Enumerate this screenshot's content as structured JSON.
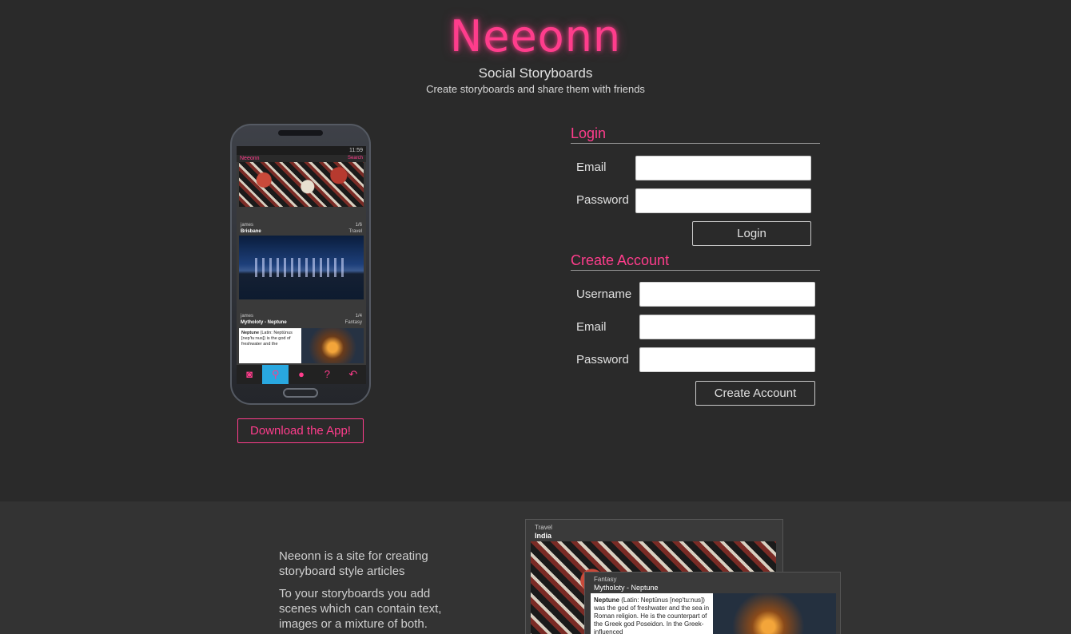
{
  "header": {
    "logo": "Neeonn",
    "tagline": "Social Storyboards",
    "subtagline": "Create storyboards and share them with friends"
  },
  "phone": {
    "status_time": "11:59",
    "app_brand": "Neeonn",
    "search_label": "Search",
    "card1": {
      "user": "james",
      "count": "1/6",
      "title": "Brisbane",
      "category": "Travel"
    },
    "card2": {
      "user": "james",
      "count": "1/4",
      "title": "Mytholoty - Neptune",
      "category": "Fantasy"
    },
    "snippet_bold": "Neptune",
    "snippet_text": "(Latin: Neptūnus [nep'tu:nus]) is the god of freshwater and the",
    "tabs": [
      {
        "icon": "camera-icon",
        "glyph": "◙"
      },
      {
        "icon": "search-icon",
        "glyph": "⚲"
      },
      {
        "icon": "user-icon",
        "glyph": "●"
      },
      {
        "icon": "help-icon",
        "glyph": "?"
      },
      {
        "icon": "back-icon",
        "glyph": "↶"
      }
    ]
  },
  "download_button": "Download the App!",
  "login": {
    "title": "Login",
    "email_label": "Email",
    "password_label": "Password",
    "button": "Login"
  },
  "create": {
    "title": "Create Account",
    "username_label": "Username",
    "email_label": "Email",
    "password_label": "Password",
    "button": "Create Account"
  },
  "about": {
    "p1": "Neeonn is a site for creating storyboard style articles",
    "p2": "To your storyboards you add scenes which can contain text, images or a mixture of both."
  },
  "preview1": {
    "category": "Travel",
    "title": "India"
  },
  "preview2": {
    "category": "Fantasy",
    "title": "Mytholoty - Neptune",
    "text_bold": "Neptune",
    "text": "(Latin: Neptūnus [nep'tu:nus]) was the god of freshwater and the sea in Roman religion. He is the counterpart of the Greek god Poseidon. In the Greek-influenced"
  },
  "colors": {
    "accent": "#ff3d8c",
    "tab_active": "#29a8e0",
    "background": "#2a2a2a"
  }
}
